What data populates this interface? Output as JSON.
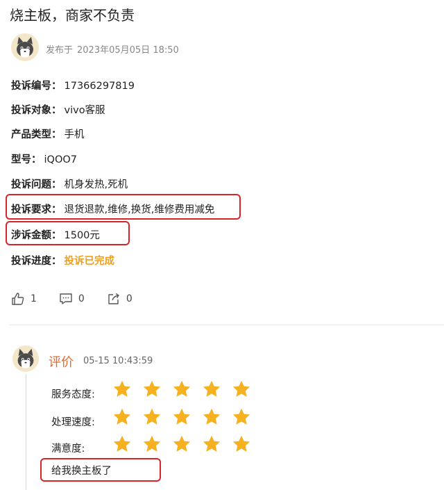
{
  "post": {
    "title": "烧主板，商家不负责",
    "published_label": "发布于",
    "published_time": "2023年05月05日 18:50"
  },
  "fields": [
    {
      "key": "投诉编号：",
      "value": "17366297819"
    },
    {
      "key": "投诉对象：",
      "value": "vivo客服"
    },
    {
      "key": "产品类型：",
      "value": "手机"
    },
    {
      "key": "型号：",
      "value": "iQOO7"
    },
    {
      "key": "投诉问题：",
      "value": "机身发热,死机"
    },
    {
      "key": "投诉要求：",
      "value": "退货退款,维修,换货,维修费用减免"
    },
    {
      "key": "涉诉金额：",
      "value": "1500元"
    },
    {
      "key": "投诉进度：",
      "value": "投诉已完成"
    }
  ],
  "actions": {
    "like_count": "1",
    "comment_count": "0",
    "share_count": "0"
  },
  "evaluation": {
    "title": "评价",
    "time": "05-15 10:43:59",
    "ratings": [
      {
        "label": "服务态度:",
        "stars": 5
      },
      {
        "label": "处理速度:",
        "stars": 5
      },
      {
        "label": "满意度:",
        "stars": 5
      }
    ],
    "comment": "给我换主板了"
  },
  "colors": {
    "accent_orange": "#e8682a",
    "status_orange": "#f0a020",
    "star": "#f5b120",
    "highlight_box": "#d8232a"
  },
  "icons": [
    "avatar-cat",
    "thumbs-up-icon",
    "comment-icon",
    "share-icon",
    "star-icon"
  ]
}
